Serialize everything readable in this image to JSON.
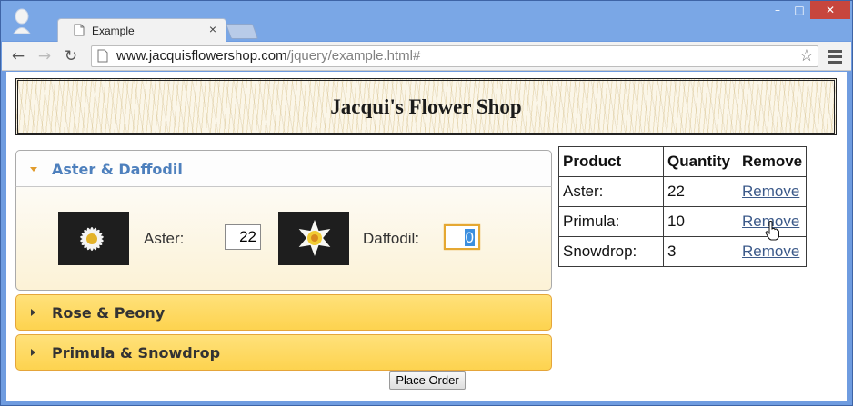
{
  "browser": {
    "tab_title": "Example",
    "tab_close": "×",
    "url_host": "www.jacquisflowershop.com",
    "url_path": "/jquery/example.html#",
    "window_controls": {
      "minimize": "–",
      "maximize": "□",
      "close": "✕"
    },
    "nav": {
      "back": "←",
      "forward": "→",
      "reload": "↻"
    },
    "star": "☆"
  },
  "page": {
    "title": "Jacqui's Flower Shop"
  },
  "accordion": {
    "active_section": {
      "label": "Aster & Daffodil",
      "items": [
        {
          "name": "Aster:",
          "quantity": "22",
          "image": "aster-flower"
        },
        {
          "name": "Daffodil:",
          "quantity": "0",
          "image": "daffodil-flower"
        }
      ]
    },
    "collapsed_sections": [
      {
        "label": "Rose & Peony"
      },
      {
        "label": "Primula & Snowdrop"
      }
    ]
  },
  "place_order_label": "Place Order",
  "basket": {
    "headers": [
      "Product",
      "Quantity",
      "Remove"
    ],
    "rows": [
      {
        "product": "Aster:",
        "quantity": "22",
        "remove": "Remove"
      },
      {
        "product": "Primula:",
        "quantity": "10",
        "remove": "Remove"
      },
      {
        "product": "Snowdrop:",
        "quantity": "3",
        "remove": "Remove"
      }
    ]
  },
  "colors": {
    "active_header_text": "#4e80bd",
    "collapsed_header_bg": "#fdd34f",
    "focus_border": "#e5a832"
  }
}
